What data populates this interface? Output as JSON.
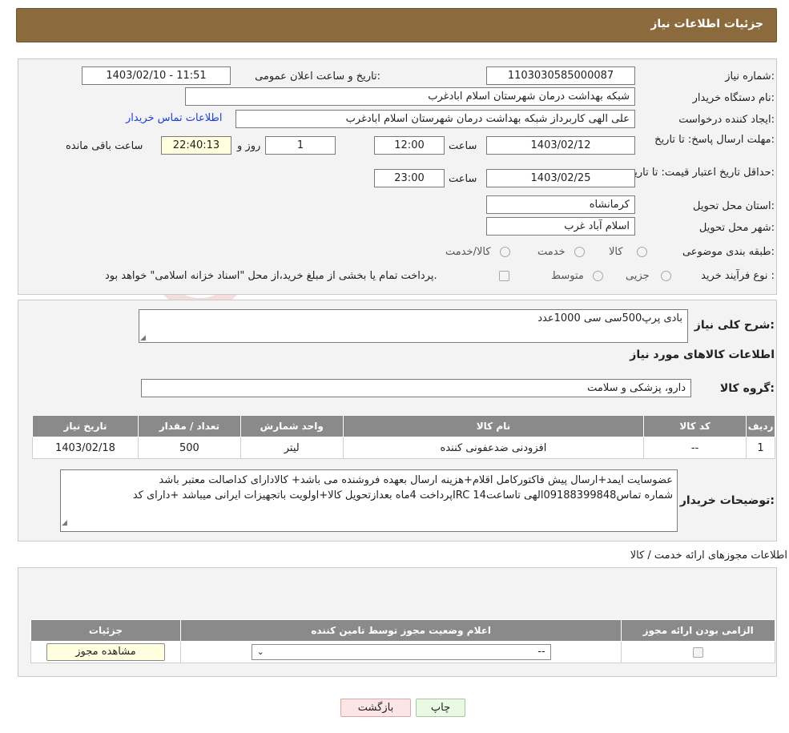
{
  "header": {
    "title": "جزئیات اطلاعات نیاز"
  },
  "watermark": {
    "text": "AriaTender.neT"
  },
  "need": {
    "need_number_label": "شماره نیاز:",
    "need_number": "1103030585000087",
    "announce_label": "تاریخ و ساعت اعلان عمومی:",
    "announce_value": "1403/02/10 - 11:51",
    "buyer_org_label": "نام دستگاه خریدار:",
    "buyer_org": "شبکه بهداشت درمان شهرستان اسلام ابادغرب",
    "creator_label": "ایجاد کننده درخواست:",
    "creator": "علی الهی کاربرداز شبکه بهداشت درمان شهرستان اسلام ابادغرب",
    "contact_link": "اطلاعات تماس خریدار",
    "deadline_label": "مهلت ارسال پاسخ: تا تاریخ:",
    "deadline_date": "1403/02/12",
    "time_label": "ساعت",
    "deadline_time": "12:00",
    "days_value": "1",
    "days_label": "روز و",
    "remaining_value": "22:40:13",
    "remaining_label": "ساعت باقی مانده",
    "validity_label": "حداقل تاریخ اعتبار قیمت: تا تاریخ:",
    "validity_date": "1403/02/25",
    "validity_time": "23:00",
    "province_label": "استان محل تحویل:",
    "province": "کرمانشاه",
    "city_label": "شهر محل تحویل:",
    "city": "اسلام آباد غرب",
    "category_label": "طبقه بندی موضوعی:",
    "category_options": [
      "کالا",
      "خدمت",
      "کالا/خدمت"
    ],
    "process_label": "نوع فرآیند خرید :",
    "process_options": [
      "جزیی",
      "متوسط"
    ],
    "process_note": "پرداخت تمام یا بخشی از مبلغ خرید،از محل \"اسناد خزانه اسلامی\" خواهد بود."
  },
  "description": {
    "label": "شرح کلی نیاز:",
    "value": "بادی پرپ500سی سی 1000عدد",
    "goods_title": "اطلاعات کالاهای مورد نیاز",
    "group_label": "گروه کالا:",
    "group_value": "دارو، پزشکی و سلامت"
  },
  "goods_table": {
    "headers": [
      "ردیف",
      "کد کالا",
      "نام کالا",
      "واحد شمارش",
      "تعداد / مقدار",
      "تاریخ نیاز"
    ],
    "rows": [
      [
        "1",
        "--",
        "افزودنی ضدعفونی کننده",
        "لیتر",
        "500",
        "1403/02/18"
      ]
    ]
  },
  "buyer_notes": {
    "label": "توضیحات خریدار:",
    "line1": "عضوسایت ایمد+ارسال پیش فاکتورکامل اقلام+هزینه ارسال بعهده فروشنده می باشد+ کالادارای کداصالت معتبر باشد",
    "line2": "پرداخت 4ماه بعدازتحویل کالا+اولویت باتجهیزات ایرانی میباشد +دارای کدIRC شماره تماس09188399848الهی تاساعت14"
  },
  "permits": {
    "title": "اطلاعات مجوزهای ارائه خدمت / کالا",
    "headers": [
      "الزامی بودن ارائه مجوز",
      "اعلام وضعیت مجوز توسط تامین کننده",
      "جزئیات"
    ],
    "select_value": "--",
    "view_button": "مشاهده مجوز"
  },
  "buttons": {
    "print": "چاپ",
    "back": "بازگشت"
  }
}
